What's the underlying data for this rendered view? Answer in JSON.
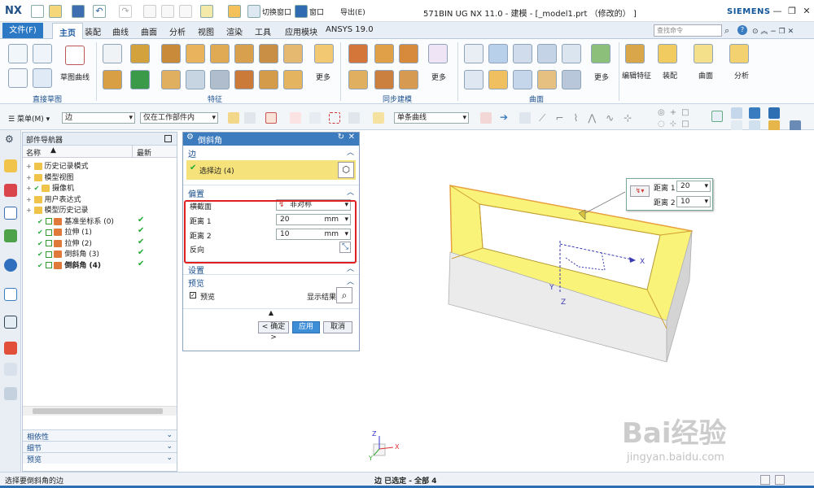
{
  "app": {
    "logo": "NX",
    "title": "571BIN UG NX 11.0 - 建模 - [_model1.prt （修改的） ]",
    "brand": "SIEMENS",
    "switch_window": "切换窗口",
    "window_menu": "窗口",
    "import_export": "导出(E)"
  },
  "tabs": [
    "文件(F)",
    "主页",
    "装配",
    "曲线",
    "曲面",
    "分析",
    "视图",
    "渲染",
    "工具",
    "应用模块",
    "ANSYS 19.0"
  ],
  "search_placeholder": "查找命令",
  "ribbon": {
    "group_direct_sketch": "直接草图",
    "group_feature": "特征",
    "group_sync": "同步建模",
    "group_surface": "曲面",
    "sketch_curve": "草图曲线",
    "more1": "更多",
    "more2": "更多",
    "more3": "更多",
    "edit_feature": "编辑特征",
    "assembly": "装配",
    "curve_surface": "曲面",
    "analysis": "分析"
  },
  "toolbar2": {
    "menu": "菜单(M)",
    "filter_edge": "边",
    "scope": "仅在工作部件内",
    "curve_rule": "单条曲线"
  },
  "navigator": {
    "title": "部件导航器",
    "col_name": "名称",
    "col_latest": "最新",
    "items": [
      {
        "label": "历史记录模式",
        "indent": 0,
        "check": false,
        "latest": false,
        "bold": false
      },
      {
        "label": "模型视图",
        "indent": 0,
        "check": false,
        "latest": false,
        "bold": false
      },
      {
        "label": "摄像机",
        "indent": 0,
        "check": true,
        "latest": false,
        "bold": false
      },
      {
        "label": "用户表达式",
        "indent": 0,
        "check": false,
        "latest": false,
        "bold": false
      },
      {
        "label": "模型历史记录",
        "indent": 0,
        "check": false,
        "latest": false,
        "bold": false
      },
      {
        "label": "基准坐标系 (0)",
        "indent": 1,
        "check": true,
        "latest": true,
        "bold": false
      },
      {
        "label": "拉伸 (1)",
        "indent": 1,
        "check": true,
        "latest": true,
        "bold": false
      },
      {
        "label": "拉伸 (2)",
        "indent": 1,
        "check": true,
        "latest": true,
        "bold": false
      },
      {
        "label": "倒斜角 (3)",
        "indent": 1,
        "check": true,
        "latest": true,
        "bold": false
      },
      {
        "label": "倒斜角 (4)",
        "indent": 1,
        "check": true,
        "latest": true,
        "bold": true
      }
    ],
    "accordions": [
      "相依性",
      "细节",
      "预览"
    ]
  },
  "dialog": {
    "title": "倒斜角",
    "sec_edge": "边",
    "select_edge": "选择边 (4)",
    "sec_offset": "偏置",
    "cross_label": "横截面",
    "cross_value": "非对称",
    "dist1_label": "距离 1",
    "dist1_value": "20",
    "dist1_unit": "mm",
    "dist2_label": "距离 2",
    "dist2_value": "10",
    "dist2_unit": "mm",
    "reverse_label": "反向",
    "sec_settings": "设置",
    "sec_preview": "预览",
    "preview_check": "预览",
    "show_result": "显示结果",
    "ok": "< 确定 >",
    "apply": "应用",
    "cancel": "取消"
  },
  "viewport": {
    "popup_d1_label": "距离 1",
    "popup_d1": "20",
    "popup_d2_label": "距离 2",
    "popup_d2": "10",
    "axis_x": "X",
    "axis_y": "Y",
    "axis_z": "Z"
  },
  "status": {
    "prompt": "选择要倒斜角的边",
    "selection": "边 已选定 - 全部 4"
  },
  "watermark": {
    "text": "Bai经验",
    "url": "jingyan.baidu.com"
  }
}
